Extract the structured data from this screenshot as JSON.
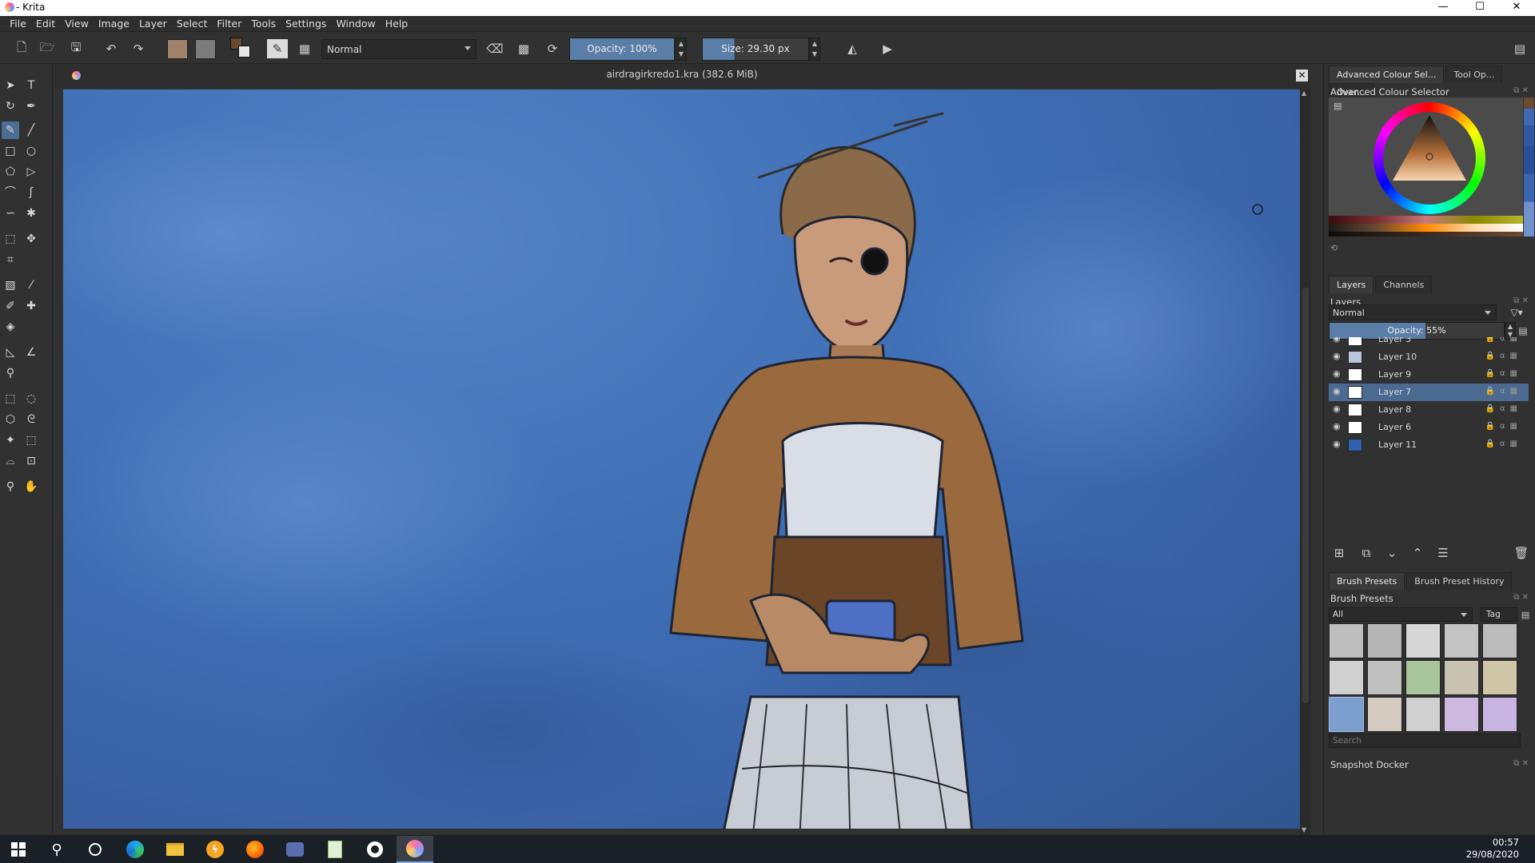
{
  "window": {
    "title": "- Krita",
    "minimize": "—",
    "maximize": "☐",
    "close": "✕"
  },
  "menu": [
    "File",
    "Edit",
    "View",
    "Image",
    "Layer",
    "Select",
    "Filter",
    "Tools",
    "Settings",
    "Window",
    "Help"
  ],
  "toolbar": {
    "blend_mode": "Normal",
    "opacity_label": "Opacity: 100%",
    "size_label": "Size: 29.30 px",
    "colors": {
      "foreground": "#a07a5c",
      "background": "#8a8a8a",
      "fg_small": "#6b4a32"
    }
  },
  "document": {
    "title": "airdragirkredo1.kra (382.6 MiB)",
    "close": "✕"
  },
  "dock": {
    "color_tabs": [
      "Advanced Colour Sel...",
      "Tool Op...",
      "Over..."
    ],
    "color_title": "Advanced Colour Selector",
    "layer_tabs": [
      "Layers",
      "Channels"
    ],
    "layers_title": "Layers",
    "layer_blend": "Normal",
    "layer_opacity": "Opacity: 55%",
    "layers": [
      {
        "name": "Layer 3",
        "selected": false
      },
      {
        "name": "Layer 10",
        "selected": false
      },
      {
        "name": "Layer 9",
        "selected": false
      },
      {
        "name": "Layer 7",
        "selected": true
      },
      {
        "name": "Layer 8",
        "selected": false
      },
      {
        "name": "Layer 6",
        "selected": false
      },
      {
        "name": "Layer 11",
        "selected": false
      }
    ],
    "brush_tabs": [
      "Brush Presets",
      "Brush Preset History"
    ],
    "brush_title": "Brush Presets",
    "brush_filter": "All",
    "brush_tag": "Tag",
    "brush_search_placeholder": "Search",
    "snapshot_title": "Snapshot Docker"
  },
  "taskbar": {
    "time": "00:57",
    "date": "29/08/2020"
  }
}
